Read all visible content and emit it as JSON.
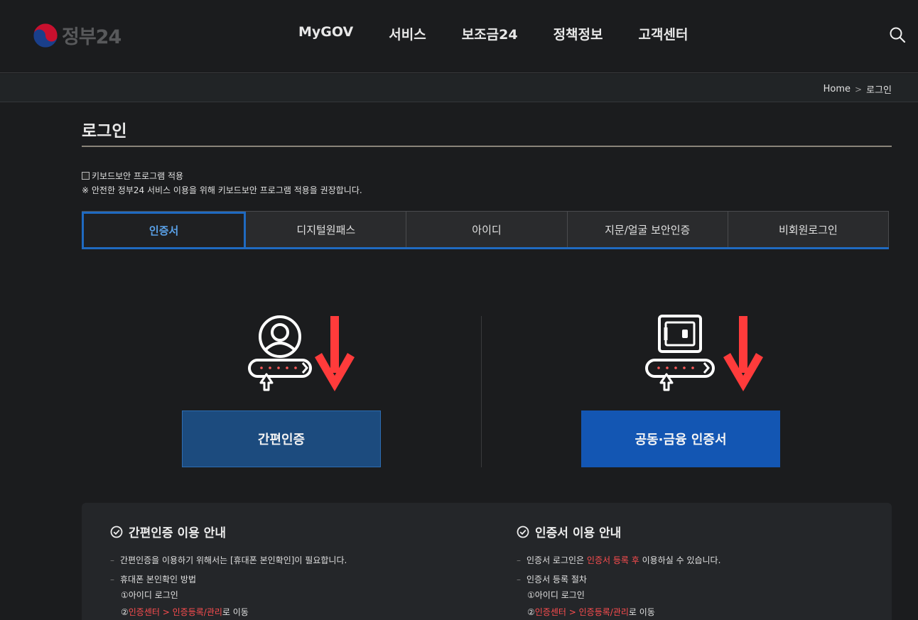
{
  "header": {
    "logo_text": "정부24",
    "nav": [
      "MyGOV",
      "서비스",
      "보조금24",
      "정책정보",
      "고객센터"
    ]
  },
  "breadcrumb": {
    "home": "Home",
    "current": "로그인"
  },
  "page": {
    "title": "로그인"
  },
  "keyboard": {
    "checkbox_label": "키보드보안 프로그램 적용",
    "note": "※ 안전한 정부24 서비스 이용을 위해 키보드보안 프로그램 적용을 권장합니다."
  },
  "tabs": [
    {
      "label": "인증서",
      "active": true
    },
    {
      "label": "디지털원패스",
      "active": false
    },
    {
      "label": "아이디",
      "active": false
    },
    {
      "label": "지문/얼굴 보안인증",
      "active": false
    },
    {
      "label": "비회원로그인",
      "active": false
    }
  ],
  "options": {
    "simple_button": "간편인증",
    "cert_button": "공동·금융 인증서"
  },
  "guide": {
    "simple": {
      "title": "간편인증 이용 안내",
      "line1": "간편인증을 이용하기 위해서는 [휴대폰 본인확인]이 필요합니다.",
      "line2": "휴대폰 본인확인 방법",
      "step1": "①아이디 로그인",
      "step2_prefix": "②",
      "step2_red": "인증센터 > 인증등록/관리",
      "step2_suffix": "로 이동"
    },
    "cert": {
      "title": "인증서 이용 안내",
      "line1_prefix": "인증서 로그인은 ",
      "line1_red": "인증서 등록 후",
      "line1_suffix": " 이용하실 수 있습니다.",
      "line2": "인증서 등록 절차",
      "step1": "①아이디 로그인",
      "step2_prefix": "②",
      "step2_red": "인증센터 > 인증등록/관리",
      "step2_suffix": "로 이동"
    }
  },
  "colors": {
    "accent_blue": "#1f6ac1",
    "simple_button_bg": "#1c4b7e",
    "cert_button_bg": "#1356b3",
    "arrow_red": "#ff3b3b",
    "highlight_red": "#ff4d4f"
  },
  "icons": {
    "logo": "taegeuk-icon",
    "search": "search-icon",
    "simple_auth": "user-card-icon",
    "cert_auth": "safe-card-icon",
    "pointer_arrow": "red-down-arrow-icon",
    "check": "check-circle-icon"
  }
}
